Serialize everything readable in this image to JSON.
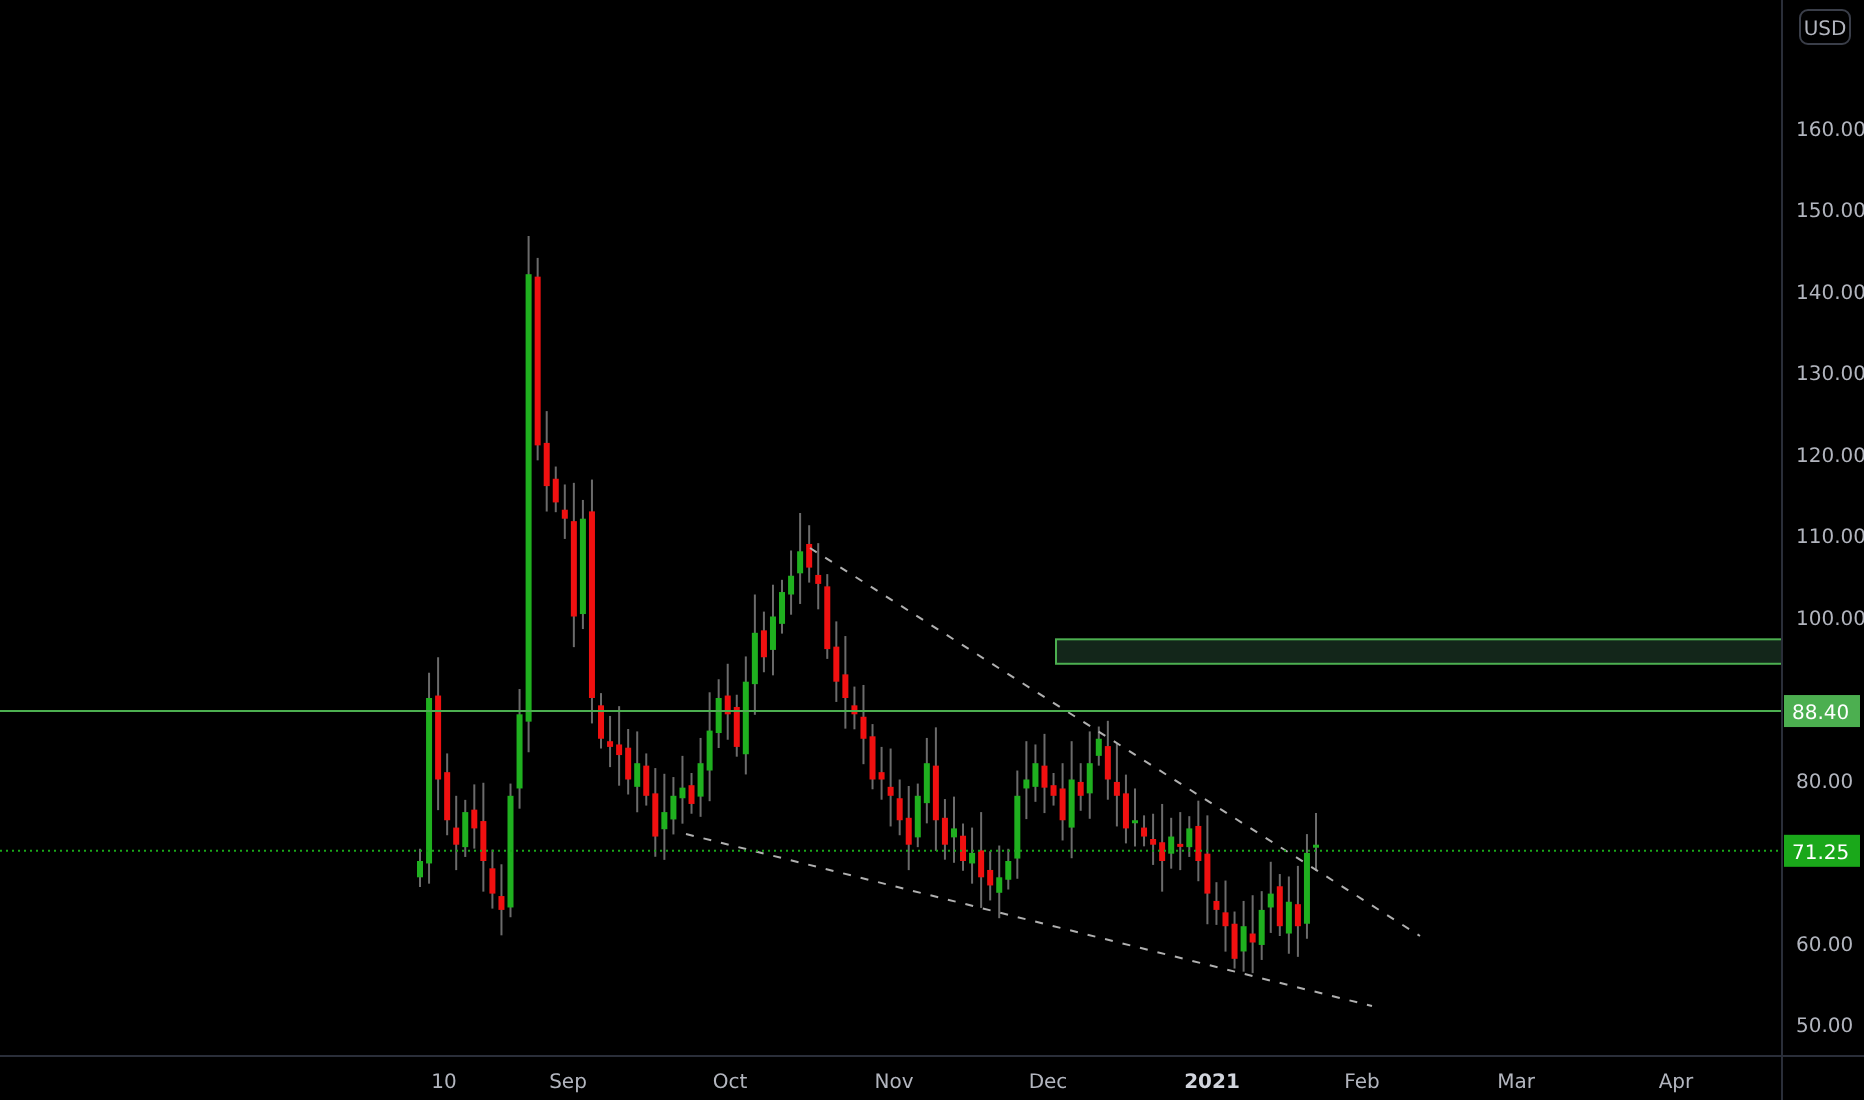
{
  "currency": "USD",
  "price_axis": {
    "ticks": [
      "160.00",
      "150.00",
      "140.00",
      "130.00",
      "120.00",
      "110.00",
      "100.00",
      "80.00",
      "60.00",
      "50.00"
    ]
  },
  "time_axis": {
    "ticks": [
      {
        "label": "10",
        "emphasis": false
      },
      {
        "label": "Sep",
        "emphasis": false
      },
      {
        "label": "Oct",
        "emphasis": false
      },
      {
        "label": "Nov",
        "emphasis": false
      },
      {
        "label": "Dec",
        "emphasis": false
      },
      {
        "label": "2021",
        "emphasis": true
      },
      {
        "label": "Feb",
        "emphasis": false
      },
      {
        "label": "Mar",
        "emphasis": false
      },
      {
        "label": "Apr",
        "emphasis": false
      }
    ]
  },
  "price_lines": [
    {
      "label": "88.40",
      "kind": "solid"
    },
    {
      "label": "71.25",
      "kind": "dotted"
    }
  ]
}
